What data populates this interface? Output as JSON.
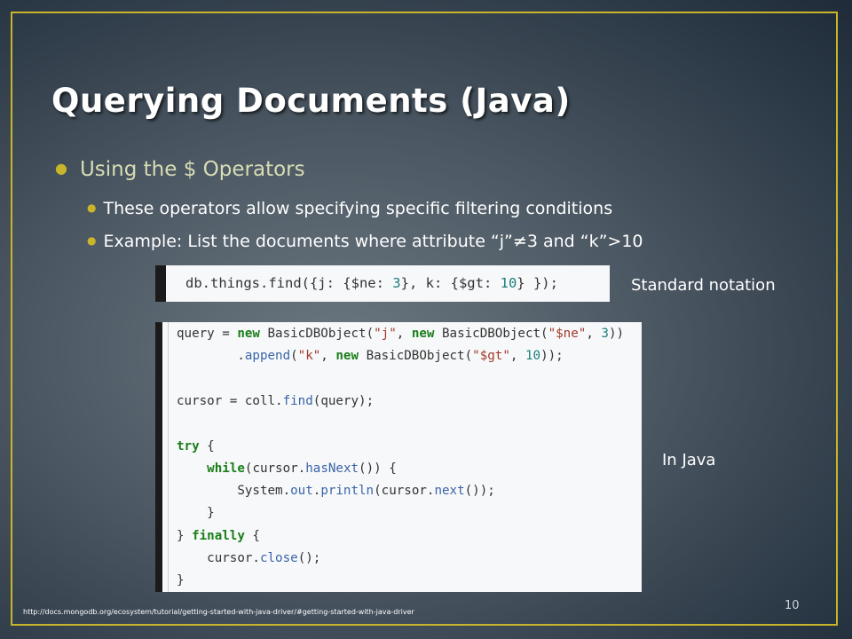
{
  "slide": {
    "title": "Querying Documents (Java)",
    "bullet_level1": "Using the $ Operators",
    "bullet_level2": [
      "These operators allow specifying specific filtering conditions",
      "Example: List the documents where attribute “j”≠3 and “k”>10"
    ],
    "label_standard": "Standard notation",
    "label_java": "In Java",
    "source_url": "http://docs.mongodb.org/ecosystem/tutorial/getting-started-with-java-driver/#getting-started-with-java-driver",
    "page_number": "10"
  },
  "code_standard": {
    "tokens": [
      "db.things.find({j: {$ne: ",
      "3",
      "}, k: {$gt: ",
      "10",
      "} });"
    ]
  },
  "code_java": {
    "lines": [
      "query = new BasicDBObject(\"j\", new BasicDBObject(\"$ne\", 3))",
      "        .append(\"k\", new BasicDBObject(\"$gt\", 10));",
      "",
      "cursor = coll.find(query);",
      "",
      "try {",
      "    while(cursor.hasNext()) {",
      "        System.out.println(cursor.next());",
      "    }",
      "} finally {",
      "    cursor.close();",
      "}"
    ]
  },
  "colors": {
    "frame": "#c9b52a",
    "title": "#ffffff",
    "bullet1": "#d8dcb4",
    "keyword": "#1a7f1a",
    "number": "#1c7f7a",
    "string": "#a23a2a"
  }
}
